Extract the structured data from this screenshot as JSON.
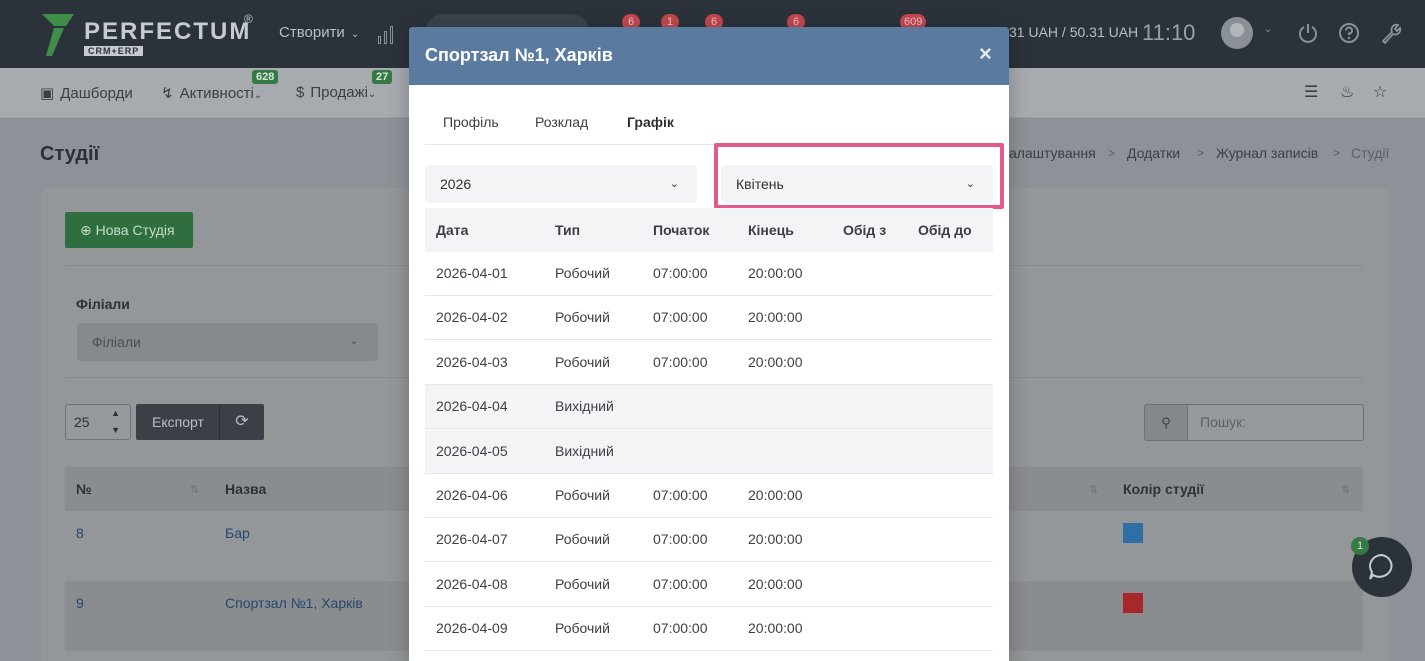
{
  "app": {
    "brand": "PERFECTUM",
    "brand_reg": "®",
    "brand_sub": "CRM+ERP",
    "create_label": "Створити",
    "badges": [
      "6",
      "1",
      "6",
      "6",
      "609"
    ],
    "balance": "31 UAH / 50.31 UAH",
    "clock": "11:10"
  },
  "nav": {
    "items": [
      {
        "label": "Дашборди"
      },
      {
        "label": "Активності",
        "badge": "628"
      },
      {
        "label": "Продажі",
        "badge": "27"
      }
    ]
  },
  "page": {
    "title": "Студії",
    "breadcrumb": [
      "алаштування",
      "Додатки",
      "Журнал записів",
      "Студії"
    ]
  },
  "toolbar": {
    "new_button": "Нова Студія",
    "filter_label": "Філіали",
    "filter_placeholder": "Філіали",
    "page_length": "25",
    "export_label": "Експорт",
    "search_placeholder": "Пошук:"
  },
  "table": {
    "columns": [
      "№",
      "Назва",
      "Колір студії"
    ],
    "rows": [
      {
        "num": "8",
        "name": "Бар",
        "color": "#2f6fa6"
      },
      {
        "num": "9",
        "name": "Спортзал №1, Харків",
        "color": "#a8272b"
      }
    ]
  },
  "chat": {
    "badge": "1"
  },
  "modal": {
    "title": "Спортзал №1, Харків",
    "close": "×",
    "tabs": [
      "Профіль",
      "Розклад",
      "Графік"
    ],
    "active_tab": "Графік",
    "year": "2026",
    "month": "Квітень",
    "columns": [
      "Дата",
      "Тип",
      "Початок",
      "Кінець",
      "Обід з",
      "Обід до"
    ],
    "rows": [
      {
        "date": "2026-04-01",
        "type": "Робочий",
        "start": "07:00:00",
        "end": "20:00:00",
        "off": false
      },
      {
        "date": "2026-04-02",
        "type": "Робочий",
        "start": "07:00:00",
        "end": "20:00:00",
        "off": false
      },
      {
        "date": "2026-04-03",
        "type": "Робочий",
        "start": "07:00:00",
        "end": "20:00:00",
        "off": false
      },
      {
        "date": "2026-04-04",
        "type": "Вихідний",
        "start": "",
        "end": "",
        "off": true
      },
      {
        "date": "2026-04-05",
        "type": "Вихідний",
        "start": "",
        "end": "",
        "off": true
      },
      {
        "date": "2026-04-06",
        "type": "Робочий",
        "start": "07:00:00",
        "end": "20:00:00",
        "off": false
      },
      {
        "date": "2026-04-07",
        "type": "Робочий",
        "start": "07:00:00",
        "end": "20:00:00",
        "off": false
      },
      {
        "date": "2026-04-08",
        "type": "Робочий",
        "start": "07:00:00",
        "end": "20:00:00",
        "off": false
      },
      {
        "date": "2026-04-09",
        "type": "Робочий",
        "start": "07:00:00",
        "end": "20:00:00",
        "off": false
      }
    ]
  }
}
